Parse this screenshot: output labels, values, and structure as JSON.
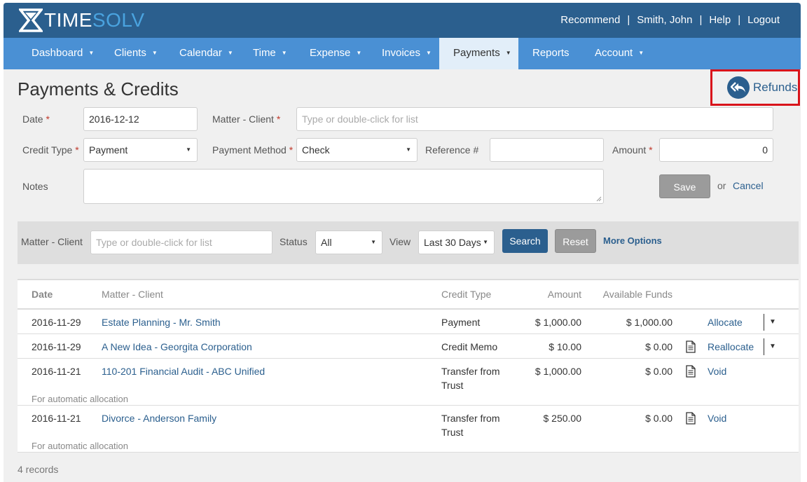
{
  "brand": {
    "name_part1": "TIME",
    "name_part2": "SOLV"
  },
  "top_links": {
    "recommend": "Recommend",
    "user": "Smith, John",
    "help": "Help",
    "logout": "Logout",
    "separator": "|"
  },
  "nav": {
    "items": [
      {
        "label": "Dashboard"
      },
      {
        "label": "Clients"
      },
      {
        "label": "Calendar"
      },
      {
        "label": "Time"
      },
      {
        "label": "Expense"
      },
      {
        "label": "Invoices"
      },
      {
        "label": "Payments"
      },
      {
        "label": "Reports"
      },
      {
        "label": "Account"
      }
    ],
    "active": "Payments"
  },
  "page": {
    "title": "Payments & Credits",
    "refunds_label": "Refunds"
  },
  "form": {
    "date_label": "Date",
    "date_value": "2016-12-12",
    "matter_client_label": "Matter - Client",
    "matter_client_placeholder": "Type or double-click for list",
    "credit_type_label": "Credit Type",
    "credit_type_value": "Payment",
    "payment_method_label": "Payment Method",
    "payment_method_value": "Check",
    "reference_label": "Reference #",
    "reference_value": "",
    "amount_label": "Amount",
    "amount_value": "0",
    "notes_label": "Notes",
    "save_label": "Save",
    "or_text": "or",
    "cancel_label": "Cancel",
    "required_mark": "*"
  },
  "filter": {
    "matter_client_label": "Matter - Client",
    "matter_client_placeholder": "Type or double-click for list",
    "status_label": "Status",
    "status_value": "All",
    "view_label": "View",
    "view_value": "Last 30 Days",
    "search_label": "Search",
    "reset_label": "Reset",
    "more_options_label": "More Options"
  },
  "table": {
    "headers": {
      "date": "Date",
      "matter_client": "Matter - Client",
      "credit_type": "Credit Type",
      "amount": "Amount",
      "available_funds": "Available Funds"
    },
    "rows": [
      {
        "date": "2016-11-29",
        "matter_client": "Estate Planning - Mr. Smith",
        "credit_type_line1": "Payment",
        "credit_type_line2": "",
        "amount": "$ 1,000.00",
        "available": "$ 1,000.00",
        "action": "Allocate",
        "note": ""
      },
      {
        "date": "2016-11-29",
        "matter_client": "A New Idea - Georgita Corporation",
        "credit_type_line1": "Credit Memo",
        "credit_type_line2": "",
        "amount": "$ 10.00",
        "available": "$ 0.00",
        "action": "Reallocate",
        "note": ""
      },
      {
        "date": "2016-11-21",
        "matter_client": "110-201 Financial Audit - ABC Unified",
        "credit_type_line1": "Transfer from",
        "credit_type_line2": "Trust",
        "amount": "$ 1,000.00",
        "available": "$ 0.00",
        "action": "Void",
        "note": "For automatic allocation"
      },
      {
        "date": "2016-11-21",
        "matter_client": "Divorce - Anderson Family",
        "credit_type_line1": "Transfer from",
        "credit_type_line2": "Trust",
        "amount": "$ 250.00",
        "available": "$ 0.00",
        "action": "Void",
        "note": "For automatic allocation"
      }
    ],
    "records_text": "4 records"
  },
  "icons": {
    "refunds": "reply-all-icon",
    "document": "document-icon",
    "caret": "caret-down-icon"
  },
  "colors": {
    "header": "#2b5f8e",
    "nav": "#4a90d4",
    "accent_link": "#2b5f8e",
    "highlight_border": "#d9141b"
  }
}
